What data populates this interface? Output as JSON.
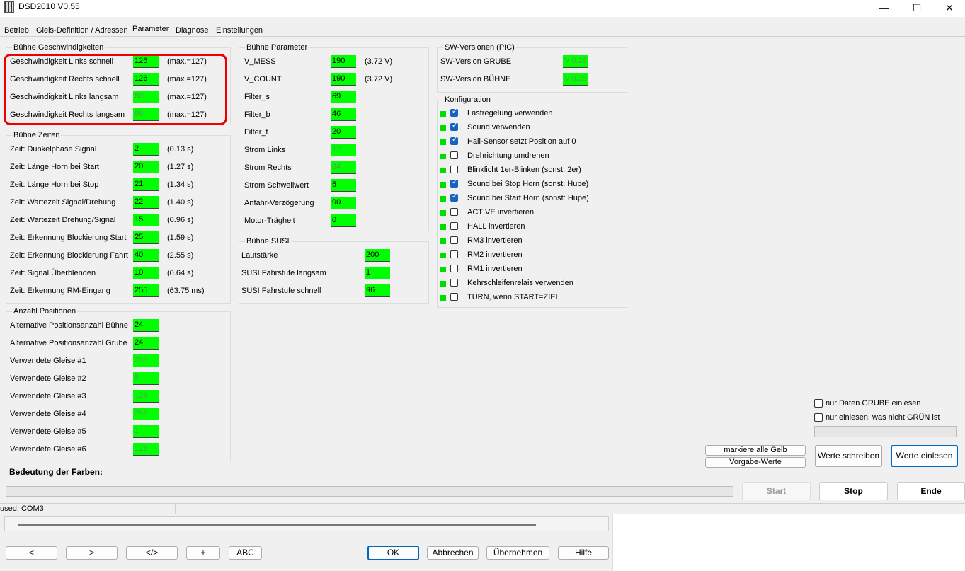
{
  "window": {
    "title": "DSD2010 V0.55",
    "minimize_glyph": "—",
    "maximize_glyph": "☐",
    "close_glyph": "✕"
  },
  "tabs": [
    "Betrieb",
    "Gleis-Definition / Adressen",
    "Parameter",
    "Diagnose",
    "Einstellungen"
  ],
  "speeds": {
    "legend": "Bühne Geschwindigkeiten",
    "rows": [
      {
        "label": "Geschwindigkeit Links schnell",
        "value": "126",
        "note": "(max.=127)"
      },
      {
        "label": "Geschwindigkeit Rechts schnell",
        "value": "126",
        "note": "(max.=127)"
      },
      {
        "label": "Geschwindigkeit Links langsam",
        "value": "80",
        "note": "(max.=127)"
      },
      {
        "label": "Geschwindigkeit Rechts langsam",
        "value": "89",
        "note": "(max.=127)"
      }
    ]
  },
  "times": {
    "legend": "Bühne Zeiten",
    "rows": [
      {
        "label": "Zeit: Dunkelphase Signal",
        "value": "2",
        "note": "(0.13 s)"
      },
      {
        "label": "Zeit: Länge Horn bei Start",
        "value": "20",
        "note": "(1.27 s)"
      },
      {
        "label": "Zeit: Länge Horn bei Stop",
        "value": "21",
        "note": "(1.34 s)"
      },
      {
        "label": "Zeit: Wartezeit Signal/Drehung",
        "value": "22",
        "note": "(1.40 s)"
      },
      {
        "label": "Zeit: Wartezeit Drehung/Signal",
        "value": "15",
        "note": "(0.96 s)"
      },
      {
        "label": "Zeit: Erkennung Blockierung Start",
        "value": "25",
        "note": "(1.59 s)"
      },
      {
        "label": "Zeit: Erkennung Blockierung Fahrt",
        "value": "40",
        "note": "(2.55 s)"
      },
      {
        "label": "Zeit: Signal Überblenden",
        "value": "10",
        "note": "(0.64 s)"
      },
      {
        "label": "Zeit: Erkennung RM-Eingang",
        "value": "255",
        "note": "(63.75 ms)"
      }
    ]
  },
  "positions": {
    "legend": "Anzahl Positionen",
    "rows": [
      {
        "label": "Alternative Positionsanzahl Bühne",
        "value": "24"
      },
      {
        "label": "Alternative Positionsanzahl Grube",
        "value": "24"
      },
      {
        "label": "Verwendete Gleise #1",
        "value": "208"
      },
      {
        "label": "Verwendete Gleise #2",
        "value": "5"
      },
      {
        "label": "Verwendete Gleise #3",
        "value": "128"
      },
      {
        "label": "Verwendete Gleise #4",
        "value": "255"
      },
      {
        "label": "Verwendete Gleise #5",
        "value": "1"
      },
      {
        "label": "Verwendete Gleise #6",
        "value": "128"
      }
    ],
    "colors_heading": "Bedeutung der Farben:"
  },
  "params": {
    "legend": "Bühne Parameter",
    "rows": [
      {
        "label": "V_MESS",
        "value": "190",
        "note": "(3.72 V)"
      },
      {
        "label": "V_COUNT",
        "value": "190",
        "note": "(3.72 V)"
      },
      {
        "label": "Filter_s",
        "value": "69",
        "note": ""
      },
      {
        "label": "Filter_b",
        "value": "46",
        "note": ""
      },
      {
        "label": "Filter_t",
        "value": "20",
        "note": ""
      },
      {
        "label": "Strom Links",
        "value": "12",
        "note": ""
      },
      {
        "label": "Strom Rechts",
        "value": "84",
        "note": ""
      },
      {
        "label": "Strom Schwellwert",
        "value": "5",
        "note": ""
      },
      {
        "label": "Anfahr-Verzögerung",
        "value": "90",
        "note": ""
      },
      {
        "label": "Motor-Trägheit",
        "value": "0",
        "note": ""
      }
    ]
  },
  "susi": {
    "legend": "Bühne SUSI",
    "rows": [
      {
        "label": "Lautstärke",
        "value": "200"
      },
      {
        "label": "SUSI Fahrstufe langsam",
        "value": "1"
      },
      {
        "label": "SUSI Fahrstufe schnell",
        "value": "96"
      }
    ]
  },
  "sw": {
    "legend": "SW-Versionen (PIC)",
    "rows": [
      {
        "label": "SW-Version GRUBE",
        "value": "V 0.29"
      },
      {
        "label": "SW-Version BÜHNE",
        "value": "V 0.25"
      }
    ]
  },
  "config": {
    "legend": "Konfiguration",
    "items": [
      {
        "label": "Lastregelung verwenden",
        "checked": true
      },
      {
        "label": "Sound verwenden",
        "checked": true
      },
      {
        "label": "Hall-Sensor setzt Position auf 0",
        "checked": true
      },
      {
        "label": "Drehrichtung umdrehen",
        "checked": false
      },
      {
        "label": "Blinklicht 1er-Blinken (sonst: 2er)",
        "checked": false
      },
      {
        "label": "Sound bei Stop Horn (sonst: Hupe)",
        "checked": true
      },
      {
        "label": "Sound bei Start Horn (sonst: Hupe)",
        "checked": true
      },
      {
        "label": "ACTIVE invertieren",
        "checked": false
      },
      {
        "label": "HALL invertieren",
        "checked": false
      },
      {
        "label": "RM3 invertieren",
        "checked": false
      },
      {
        "label": "RM2 invertieren",
        "checked": false
      },
      {
        "label": "RM1 invertieren",
        "checked": false
      },
      {
        "label": "Kehrschleifenrelais verwenden",
        "checked": false
      },
      {
        "label": "TURN, wenn START=ZIEL",
        "checked": false
      }
    ]
  },
  "options": {
    "read_grube_only": "nur Daten GRUBE einlesen",
    "read_not_green": "nur einlesen, was nicht GRÜN ist"
  },
  "buttons": {
    "mark_yellow": "markiere alle Gelb",
    "defaults": "Vorgabe-Werte",
    "write": "Werte schreiben",
    "read": "Werte einlesen",
    "start": "Start",
    "stop": "Stop",
    "end": "Ende"
  },
  "status": {
    "port": "used: COM3"
  },
  "dialog": {
    "prev": "<",
    "next": ">",
    "code": "</>",
    "plus": "+",
    "abc": "ABC",
    "ok": "OK",
    "cancel": "Abbrechen",
    "apply": "Übernehmen",
    "help": "Hilfe"
  },
  "colors": {
    "value_green": "#00ff00",
    "highlight_red": "#e00000",
    "focus_blue": "#0067c0"
  }
}
